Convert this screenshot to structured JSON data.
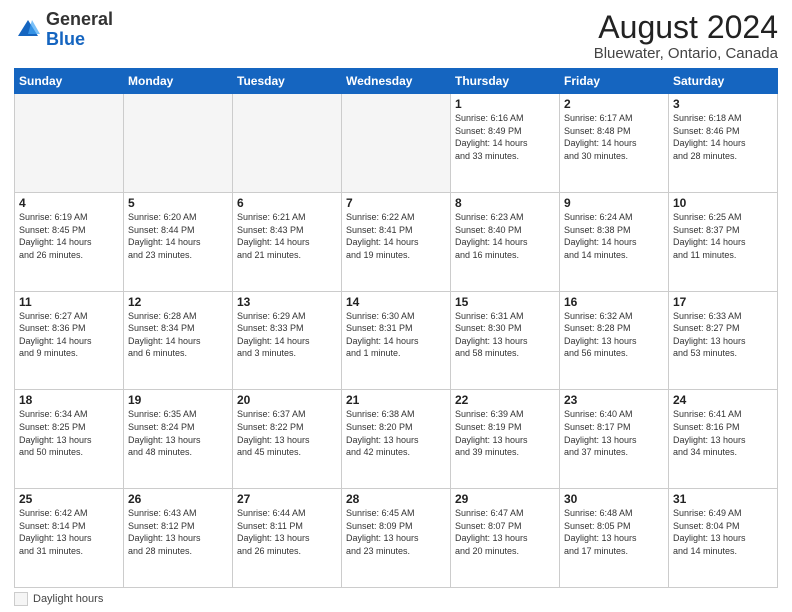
{
  "header": {
    "logo_general": "General",
    "logo_blue": "Blue",
    "month_title": "August 2024",
    "location": "Bluewater, Ontario, Canada"
  },
  "days_of_week": [
    "Sunday",
    "Monday",
    "Tuesday",
    "Wednesday",
    "Thursday",
    "Friday",
    "Saturday"
  ],
  "weeks": [
    [
      {
        "day": "",
        "info": ""
      },
      {
        "day": "",
        "info": ""
      },
      {
        "day": "",
        "info": ""
      },
      {
        "day": "",
        "info": ""
      },
      {
        "day": "1",
        "info": "Sunrise: 6:16 AM\nSunset: 8:49 PM\nDaylight: 14 hours\nand 33 minutes."
      },
      {
        "day": "2",
        "info": "Sunrise: 6:17 AM\nSunset: 8:48 PM\nDaylight: 14 hours\nand 30 minutes."
      },
      {
        "day": "3",
        "info": "Sunrise: 6:18 AM\nSunset: 8:46 PM\nDaylight: 14 hours\nand 28 minutes."
      }
    ],
    [
      {
        "day": "4",
        "info": "Sunrise: 6:19 AM\nSunset: 8:45 PM\nDaylight: 14 hours\nand 26 minutes."
      },
      {
        "day": "5",
        "info": "Sunrise: 6:20 AM\nSunset: 8:44 PM\nDaylight: 14 hours\nand 23 minutes."
      },
      {
        "day": "6",
        "info": "Sunrise: 6:21 AM\nSunset: 8:43 PM\nDaylight: 14 hours\nand 21 minutes."
      },
      {
        "day": "7",
        "info": "Sunrise: 6:22 AM\nSunset: 8:41 PM\nDaylight: 14 hours\nand 19 minutes."
      },
      {
        "day": "8",
        "info": "Sunrise: 6:23 AM\nSunset: 8:40 PM\nDaylight: 14 hours\nand 16 minutes."
      },
      {
        "day": "9",
        "info": "Sunrise: 6:24 AM\nSunset: 8:38 PM\nDaylight: 14 hours\nand 14 minutes."
      },
      {
        "day": "10",
        "info": "Sunrise: 6:25 AM\nSunset: 8:37 PM\nDaylight: 14 hours\nand 11 minutes."
      }
    ],
    [
      {
        "day": "11",
        "info": "Sunrise: 6:27 AM\nSunset: 8:36 PM\nDaylight: 14 hours\nand 9 minutes."
      },
      {
        "day": "12",
        "info": "Sunrise: 6:28 AM\nSunset: 8:34 PM\nDaylight: 14 hours\nand 6 minutes."
      },
      {
        "day": "13",
        "info": "Sunrise: 6:29 AM\nSunset: 8:33 PM\nDaylight: 14 hours\nand 3 minutes."
      },
      {
        "day": "14",
        "info": "Sunrise: 6:30 AM\nSunset: 8:31 PM\nDaylight: 14 hours\nand 1 minute."
      },
      {
        "day": "15",
        "info": "Sunrise: 6:31 AM\nSunset: 8:30 PM\nDaylight: 13 hours\nand 58 minutes."
      },
      {
        "day": "16",
        "info": "Sunrise: 6:32 AM\nSunset: 8:28 PM\nDaylight: 13 hours\nand 56 minutes."
      },
      {
        "day": "17",
        "info": "Sunrise: 6:33 AM\nSunset: 8:27 PM\nDaylight: 13 hours\nand 53 minutes."
      }
    ],
    [
      {
        "day": "18",
        "info": "Sunrise: 6:34 AM\nSunset: 8:25 PM\nDaylight: 13 hours\nand 50 minutes."
      },
      {
        "day": "19",
        "info": "Sunrise: 6:35 AM\nSunset: 8:24 PM\nDaylight: 13 hours\nand 48 minutes."
      },
      {
        "day": "20",
        "info": "Sunrise: 6:37 AM\nSunset: 8:22 PM\nDaylight: 13 hours\nand 45 minutes."
      },
      {
        "day": "21",
        "info": "Sunrise: 6:38 AM\nSunset: 8:20 PM\nDaylight: 13 hours\nand 42 minutes."
      },
      {
        "day": "22",
        "info": "Sunrise: 6:39 AM\nSunset: 8:19 PM\nDaylight: 13 hours\nand 39 minutes."
      },
      {
        "day": "23",
        "info": "Sunrise: 6:40 AM\nSunset: 8:17 PM\nDaylight: 13 hours\nand 37 minutes."
      },
      {
        "day": "24",
        "info": "Sunrise: 6:41 AM\nSunset: 8:16 PM\nDaylight: 13 hours\nand 34 minutes."
      }
    ],
    [
      {
        "day": "25",
        "info": "Sunrise: 6:42 AM\nSunset: 8:14 PM\nDaylight: 13 hours\nand 31 minutes."
      },
      {
        "day": "26",
        "info": "Sunrise: 6:43 AM\nSunset: 8:12 PM\nDaylight: 13 hours\nand 28 minutes."
      },
      {
        "day": "27",
        "info": "Sunrise: 6:44 AM\nSunset: 8:11 PM\nDaylight: 13 hours\nand 26 minutes."
      },
      {
        "day": "28",
        "info": "Sunrise: 6:45 AM\nSunset: 8:09 PM\nDaylight: 13 hours\nand 23 minutes."
      },
      {
        "day": "29",
        "info": "Sunrise: 6:47 AM\nSunset: 8:07 PM\nDaylight: 13 hours\nand 20 minutes."
      },
      {
        "day": "30",
        "info": "Sunrise: 6:48 AM\nSunset: 8:05 PM\nDaylight: 13 hours\nand 17 minutes."
      },
      {
        "day": "31",
        "info": "Sunrise: 6:49 AM\nSunset: 8:04 PM\nDaylight: 13 hours\nand 14 minutes."
      }
    ]
  ],
  "footer": {
    "legend_label": "Daylight hours"
  }
}
